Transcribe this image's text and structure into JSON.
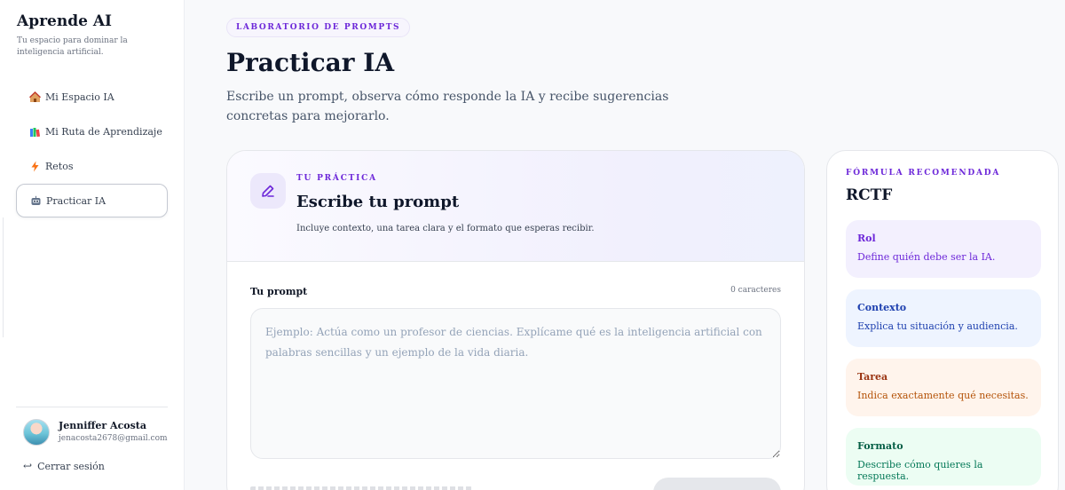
{
  "brand": {
    "title": "Aprende AI",
    "subtitle": "Tu espacio para dominar la inteligencia artificial."
  },
  "nav": {
    "items": [
      {
        "label": "Mi Espacio IA",
        "icon": "house-icon"
      },
      {
        "label": "Mi Ruta de Aprendizaje",
        "icon": "books-icon"
      },
      {
        "label": "Retos",
        "icon": "lightning-icon"
      },
      {
        "label": "Practicar IA",
        "icon": "robot-icon",
        "active": true
      }
    ]
  },
  "user": {
    "name": "Jenniffer Acosta",
    "email": "jenacosta2678@gmail.com",
    "logout_label": "Cerrar sesión"
  },
  "main": {
    "badge": "LABORATORIO DE PROMPTS",
    "title": "Practicar IA",
    "description": "Escribe un prompt, observa cómo responde la IA y recibe sugerencias concretas para mejorarlo."
  },
  "practice": {
    "kicker": "TU PRÁCTICA",
    "title": "Escribe tu prompt",
    "subtitle": "Incluye contexto, una tarea clara y el formato que esperas recibir.",
    "field_label": "Tu prompt",
    "char_count": "0 caracteres",
    "placeholder": "Ejemplo: Actúa como un profesor de ciencias. Explícame qué es la inteligencia artificial con palabras sencillas y un ejemplo de la vida diaria.",
    "value": ""
  },
  "formula": {
    "kicker": "FÓRMULA RECOMENDADA",
    "title": "RCTF",
    "items": [
      {
        "name": "Rol",
        "desc": "Define quién debe ser la IA."
      },
      {
        "name": "Contexto",
        "desc": "Explica tu situación y audiencia."
      },
      {
        "name": "Tarea",
        "desc": "Indica exactamente qué necesitas."
      },
      {
        "name": "Formato",
        "desc": "Describe cómo quieres la respuesta."
      }
    ]
  },
  "colors": {
    "accent": "#6d28d9",
    "rol_bg": "#f3f0fe",
    "contexto_bg": "#eef4ff",
    "tarea_bg": "#fff4ec",
    "formato_bg": "#ecfdf3"
  }
}
